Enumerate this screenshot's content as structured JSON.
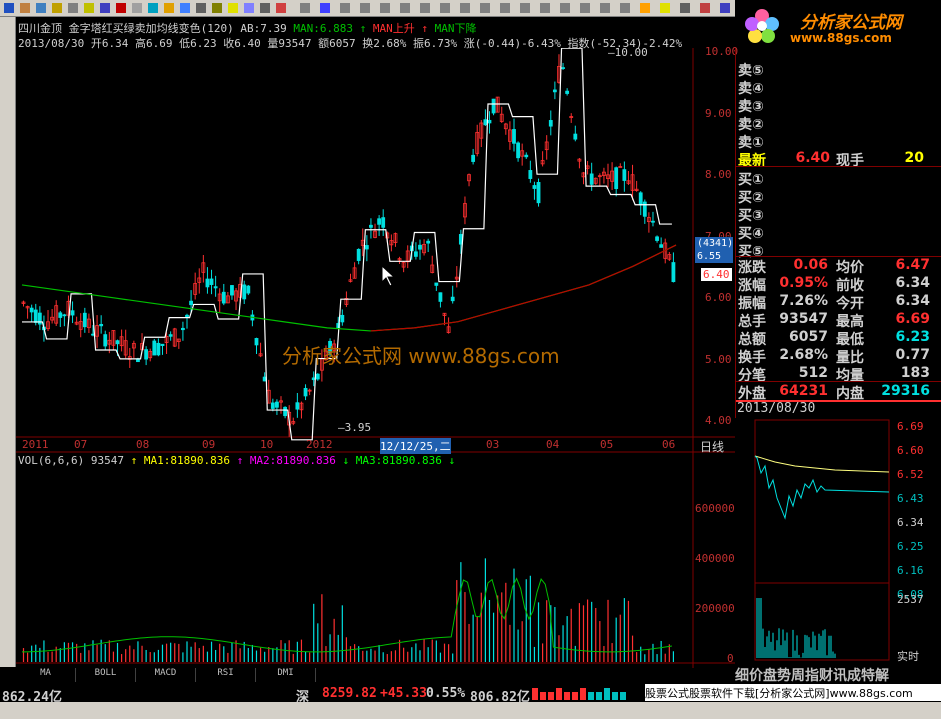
{
  "stock": {
    "name": "四川金顶",
    "indicator_title": "金字塔红买绿卖加均线变色(120)",
    "ab": "AB:7.39",
    "man": "MAN:6.883",
    "man_up": "MAN上升",
    "man_down": "MAN下降"
  },
  "info_line": {
    "date": "2013/08/30",
    "open": "开6.34",
    "high": "高6.69",
    "low": "低6.23",
    "close": "收6.40",
    "volume": "量93547",
    "amount": "额6057",
    "turnover": "换2.68%",
    "amplitude": "振6.73%",
    "change": "涨(-0.44)-6.43%",
    "index": "指数(-52.34)-2.42%"
  },
  "price_axis": [
    "10.00",
    "9.00",
    "8.00",
    "7.00",
    "6.00",
    "5.00",
    "4.00"
  ],
  "price_markers": {
    "high": "10.00",
    "low": "3.95",
    "current": "6.40",
    "cursor_top": "(4341)",
    "cursor_val": "6.55"
  },
  "x_axis": [
    "2011",
    "07",
    "08",
    "09",
    "10",
    "2012",
    "12/12/25,二",
    "03",
    "04",
    "05",
    "06"
  ],
  "x_axis_tail": "日线",
  "volume": {
    "header": "VOL(6,6,6) 93547",
    "ma1": "MA1:81890.836",
    "ma2": "MA2:81890.836",
    "ma3": "MA3:81890.836",
    "axis": [
      "600000",
      "400000",
      "200000",
      "0"
    ]
  },
  "quote": {
    "sell": [
      "卖⑤",
      "卖④",
      "卖③",
      "卖②",
      "卖①"
    ],
    "latest_label": "最新",
    "latest": "6.40",
    "xianshou_label": "现手",
    "xianshou": "20",
    "buy": [
      "买①",
      "买②",
      "买③",
      "买④",
      "买⑤"
    ],
    "rows": [
      {
        "l1": "涨跌",
        "v1": "0.06",
        "l2": "均价",
        "v2": "6.47",
        "c1": "#ff3030",
        "c2": "#ff3030"
      },
      {
        "l1": "涨幅",
        "v1": "0.95%",
        "l2": "前收",
        "v2": "6.34",
        "c1": "#ff3030",
        "c2": "#d0d0d0"
      },
      {
        "l1": "振幅",
        "v1": "7.26%",
        "l2": "今开",
        "v2": "6.34",
        "c1": "#d0d0d0",
        "c2": "#d0d0d0"
      },
      {
        "l1": "总手",
        "v1": "93547",
        "l2": "最高",
        "v2": "6.69",
        "c1": "#d0d0d0",
        "c2": "#ff3030"
      },
      {
        "l1": "总额",
        "v1": "6057",
        "l2": "最低",
        "v2": "6.23",
        "c1": "#d0d0d0",
        "c2": "#00e0e0"
      },
      {
        "l1": "换手",
        "v1": "2.68%",
        "l2": "量比",
        "v2": "0.77",
        "c1": "#d0d0d0",
        "c2": "#d0d0d0"
      },
      {
        "l1": "分笔",
        "v1": "512",
        "l2": "均量",
        "v2": "183",
        "c1": "#d0d0d0",
        "c2": "#d0d0d0"
      }
    ],
    "outer_label": "外盘",
    "outer": "64231",
    "inner_label": "内盘",
    "inner": "29316"
  },
  "mini": {
    "date": "2013/08/30",
    "axis": [
      "6.69",
      "6.60",
      "6.52",
      "6.43",
      "6.34",
      "6.25",
      "6.16",
      "6.08"
    ],
    "vol": "2537",
    "realtime": "实时"
  },
  "info_tabs": "细价盘势周指财讯成特解",
  "bottom_tabs": [
    "MA",
    "BOLL",
    "MACD",
    "RSI",
    "DMI"
  ],
  "status": {
    "left_val": "862.24亿",
    "sz_label": "深",
    "sz_index": "8259.82",
    "sz_change": "+45.33",
    "sz_pct": "0.55%",
    "sz_amount": "806.82亿",
    "ad": "股票公式股票软件下载[分析家公式网]www.88gs.com"
  },
  "logo": {
    "name": "分析家公式网",
    "url": "www.88gs.com"
  },
  "watermark": "分析家公式网 www.88gs.com",
  "colors": {
    "up": "#ff3030",
    "down": "#00ffff",
    "ma_green": "#00c000",
    "ma_red": "#c00000",
    "white": "#ffffff",
    "grid": "#800000"
  }
}
